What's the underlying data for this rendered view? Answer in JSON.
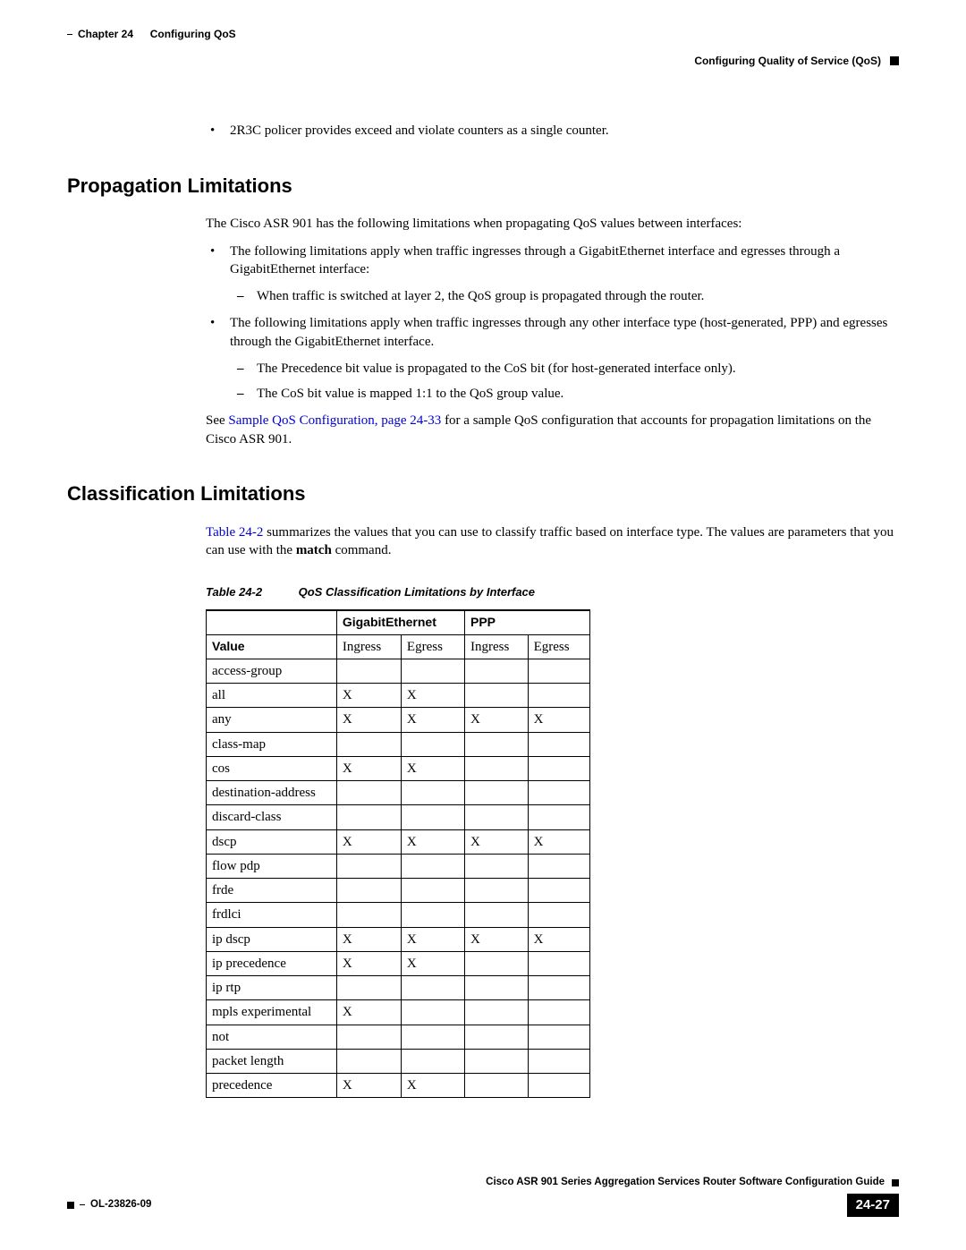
{
  "header": {
    "chapter_label": "Chapter 24",
    "chapter_title": "Configuring QoS",
    "section_title": "Configuring Quality of Service (QoS)"
  },
  "top_bullet": "2R3C policer provides exceed and violate counters as a single counter.",
  "section1": {
    "heading": "Propagation Limitations",
    "intro": "The Cisco ASR 901 has the following limitations when propagating QoS values between interfaces:",
    "b1": "The following limitations apply when traffic ingresses through a GigabitEthernet interface and egresses through a GigabitEthernet interface:",
    "b1_s1": "When traffic is switched at layer 2, the QoS group is propagated through the router.",
    "b2": "The following limitations apply when traffic ingresses through any other interface type (host-generated, PPP) and egresses through the GigabitEthernet interface.",
    "b2_s1": "The Precedence bit value is propagated to the CoS bit (for host-generated interface only).",
    "b2_s2": "The CoS bit value is mapped 1:1 to the QoS group value.",
    "see_pre": "See ",
    "see_link": "Sample QoS Configuration, page 24-33",
    "see_post": " for a sample QoS configuration that accounts for propagation limitations on the Cisco ASR 901."
  },
  "section2": {
    "heading": "Classification Limitations",
    "intro_link": "Table 24-2",
    "intro_post": " summarizes the values that you can use to classify traffic based on interface type. The values are parameters that you can use with the ",
    "intro_cmd": "match",
    "intro_end": " command.",
    "table_caption_label": "Table 24-2",
    "table_caption_title": "QoS Classification Limitations by Interface",
    "col_ge": "GigabitEthernet",
    "col_ppp": "PPP",
    "row_value": "Value",
    "sub_ingress": "Ingress",
    "sub_egress": "Egress",
    "rows": [
      {
        "v": "access-group",
        "ge_in": "",
        "ge_eg": "",
        "p_in": "",
        "p_eg": ""
      },
      {
        "v": "all",
        "ge_in": "X",
        "ge_eg": "X",
        "p_in": "",
        "p_eg": ""
      },
      {
        "v": "any",
        "ge_in": "X",
        "ge_eg": "X",
        "p_in": "X",
        "p_eg": "X"
      },
      {
        "v": "class-map",
        "ge_in": "",
        "ge_eg": "",
        "p_in": "",
        "p_eg": ""
      },
      {
        "v": "cos",
        "ge_in": "X",
        "ge_eg": "X",
        "p_in": "",
        "p_eg": ""
      },
      {
        "v": "destination-address",
        "ge_in": "",
        "ge_eg": "",
        "p_in": "",
        "p_eg": ""
      },
      {
        "v": "discard-class",
        "ge_in": "",
        "ge_eg": "",
        "p_in": "",
        "p_eg": ""
      },
      {
        "v": "dscp",
        "ge_in": "X",
        "ge_eg": "X",
        "p_in": "X",
        "p_eg": "X"
      },
      {
        "v": "flow pdp",
        "ge_in": "",
        "ge_eg": "",
        "p_in": "",
        "p_eg": ""
      },
      {
        "v": "frde",
        "ge_in": "",
        "ge_eg": "",
        "p_in": "",
        "p_eg": ""
      },
      {
        "v": "frdlci",
        "ge_in": "",
        "ge_eg": "",
        "p_in": "",
        "p_eg": ""
      },
      {
        "v": "ip dscp",
        "ge_in": "X",
        "ge_eg": "X",
        "p_in": "X",
        "p_eg": "X"
      },
      {
        "v": "ip precedence",
        "ge_in": "X",
        "ge_eg": "X",
        "p_in": "",
        "p_eg": ""
      },
      {
        "v": "ip rtp",
        "ge_in": "",
        "ge_eg": "",
        "p_in": "",
        "p_eg": ""
      },
      {
        "v": "mpls experimental",
        "ge_in": "X",
        "ge_eg": "",
        "p_in": "",
        "p_eg": ""
      },
      {
        "v": "not",
        "ge_in": "",
        "ge_eg": "",
        "p_in": "",
        "p_eg": ""
      },
      {
        "v": "packet length",
        "ge_in": "",
        "ge_eg": "",
        "p_in": "",
        "p_eg": ""
      },
      {
        "v": "precedence",
        "ge_in": "X",
        "ge_eg": "X",
        "p_in": "",
        "p_eg": ""
      }
    ]
  },
  "footer": {
    "guide": "Cisco ASR 901 Series Aggregation Services Router Software Configuration Guide",
    "doc_id": "OL-23826-09",
    "page_number": "24-27"
  }
}
